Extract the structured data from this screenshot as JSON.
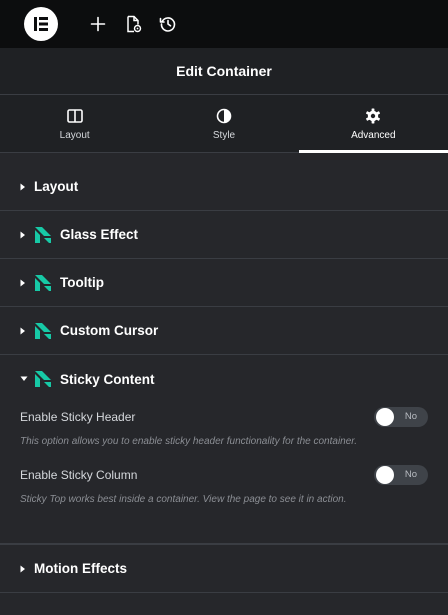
{
  "header": {
    "panel_title": "Edit Container"
  },
  "tabs": [
    {
      "label": "Layout",
      "icon": "columns-icon"
    },
    {
      "label": "Style",
      "icon": "half-circle-icon"
    },
    {
      "label": "Advanced",
      "icon": "gear-icon",
      "active": true
    }
  ],
  "sections": {
    "layout": "Layout",
    "glass": "Glass Effect",
    "tooltip": "Tooltip",
    "cursor": "Custom Cursor",
    "sticky": "Sticky Content",
    "motion": "Motion Effects"
  },
  "sticky": {
    "header_label": "Enable Sticky Header",
    "header_toggle": "No",
    "header_desc": "This option allows you to enable sticky header functionality for the container.",
    "column_label": "Enable Sticky Column",
    "column_toggle": "No",
    "column_desc": "Sticky Top works best inside a container. View the page to see it in action."
  },
  "colors": {
    "brand": "#17c9a6",
    "panel": "#26272b",
    "topbar": "#0c0d0e"
  }
}
